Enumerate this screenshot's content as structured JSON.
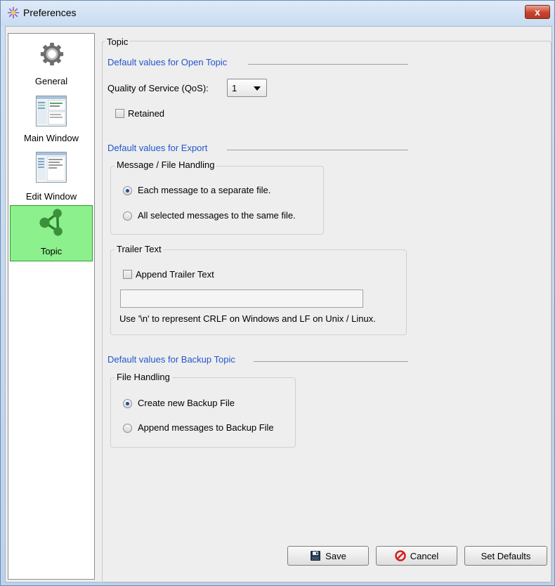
{
  "window": {
    "title": "Preferences",
    "close_label": "x"
  },
  "sidebar": {
    "items": [
      {
        "label": "General",
        "icon": "gear-icon",
        "selected": false
      },
      {
        "label": "Main Window",
        "icon": "main-window-thumbnail-icon",
        "selected": false
      },
      {
        "label": "Edit Window",
        "icon": "edit-window-thumbnail-icon",
        "selected": false
      },
      {
        "label": "Topic",
        "icon": "share-nodes-icon",
        "selected": true
      }
    ]
  },
  "panel": {
    "heading": "Topic",
    "open_topic": {
      "title": "Default values for Open Topic",
      "qos_label": "Quality of Service (QoS):",
      "qos_value": "1",
      "retained_label": "Retained",
      "retained_checked": false
    },
    "export": {
      "title": "Default values for Export",
      "message_handling": {
        "title": "Message / File Handling",
        "options": [
          {
            "label": "Each message to a separate file.",
            "checked": true
          },
          {
            "label": "All selected messages to the same file.",
            "checked": false
          }
        ]
      },
      "trailer": {
        "title": "Trailer Text",
        "append_label": "Append Trailer Text",
        "append_checked": false,
        "input_value": "",
        "hint": "Use '\\n' to represent CRLF on Windows and LF on Unix / Linux."
      }
    },
    "backup": {
      "title": "Default values for Backup Topic",
      "file_handling": {
        "title": "File Handling",
        "options": [
          {
            "label": "Create new Backup File",
            "checked": true
          },
          {
            "label": "Append messages to Backup File",
            "checked": false
          }
        ]
      }
    }
  },
  "buttons": {
    "save": "Save",
    "cancel": "Cancel",
    "set_defaults": "Set Defaults"
  },
  "colors": {
    "section_title": "#2255cc",
    "selected_sidebar": "#8cf08c",
    "close_button": "#c8432c"
  }
}
